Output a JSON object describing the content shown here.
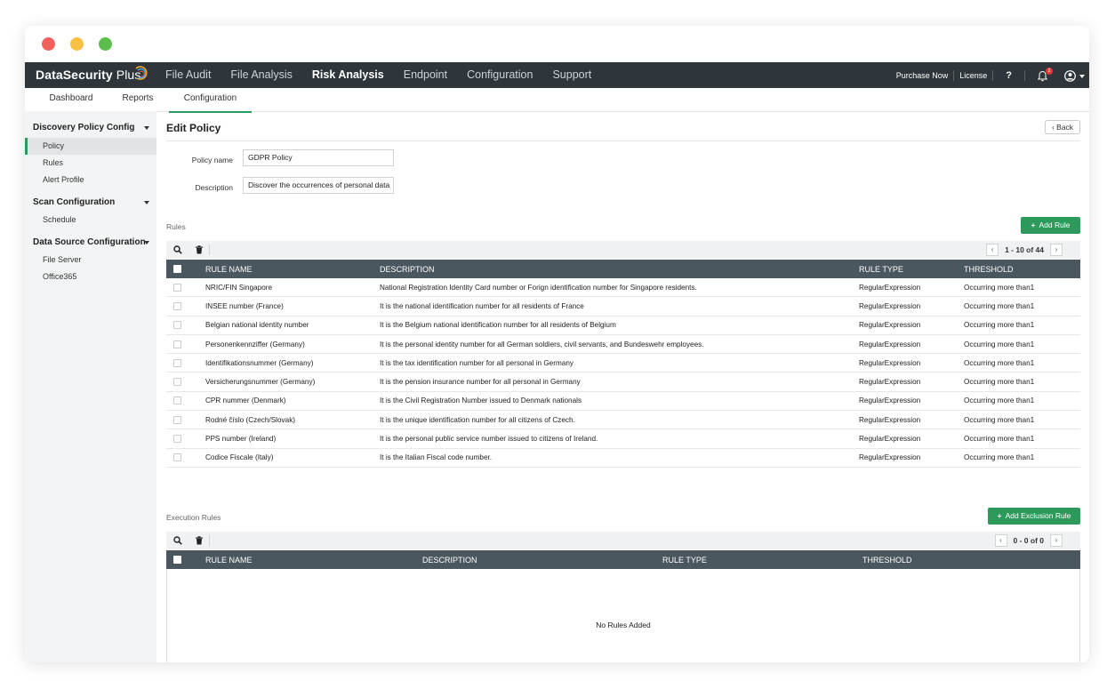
{
  "app": {
    "name": "DataSecurity",
    "name_suffix": " Plus"
  },
  "main_nav": [
    {
      "label": "File Audit",
      "active": false
    },
    {
      "label": "File Analysis",
      "active": false
    },
    {
      "label": "Risk Analysis",
      "active": true
    },
    {
      "label": "Endpoint",
      "active": false
    },
    {
      "label": "Configuration",
      "active": false
    },
    {
      "label": "Support",
      "active": false
    }
  ],
  "top_right": {
    "purchase": "Purchase Now",
    "license": "License",
    "help": "?",
    "notification_count": "2"
  },
  "sub_nav": {
    "dashboard": "Dashboard",
    "reports": "Reports",
    "configuration": "Configuration"
  },
  "sidebar": {
    "discovery": "Discovery Policy Config",
    "policy": "Policy",
    "rules": "Rules",
    "alert_profile": "Alert Profile",
    "scan": "Scan Configuration",
    "schedule": "Schedule",
    "data_source": "Data Source Configuration",
    "file_server": "File Server",
    "office365": "Office365"
  },
  "page": {
    "title": "Edit Policy",
    "back": "Back",
    "policy_name_label": "Policy name",
    "policy_name_value": "GDPR Policy",
    "description_label": "Description",
    "description_value": "Discover the occurrences of personal data"
  },
  "rules": {
    "label": "Rules",
    "add_button": "Add Rule",
    "pager": "1 - 10 of 44",
    "columns": {
      "name": "RULE NAME",
      "description": "DESCRIPTION",
      "type": "RULE TYPE",
      "threshold": "THRESHOLD"
    },
    "rows": [
      {
        "name": "NRIC/FIN Singapore",
        "description": "National Registration Identity Card number or Forign identification number for Singapore residents.",
        "type": "RegularExpression",
        "threshold": "Occurring more than1"
      },
      {
        "name": "INSEE number (France)",
        "description": "It is the national identification number for all residents of France",
        "type": "RegularExpression",
        "threshold": "Occurring more than1"
      },
      {
        "name": "Belgian national identity number",
        "description": "It is the Belgium national identification number for all residents of Belgium",
        "type": "RegularExpression",
        "threshold": "Occurring more than1"
      },
      {
        "name": "Personenkennziffer (Germany)",
        "description": "It is the personal identity number for all German soldiers, civil servants, and Bundeswehr employees.",
        "type": "RegularExpression",
        "threshold": "Occurring more than1"
      },
      {
        "name": "Identifikationsnummer (Germany)",
        "description": "It is the tax identification number for all personal in Germany",
        "type": "RegularExpression",
        "threshold": "Occurring more than1"
      },
      {
        "name": "Versicherungsnummer (Germany)",
        "description": "It is the pension insurance number for all personal in Germany",
        "type": "RegularExpression",
        "threshold": "Occurring more than1"
      },
      {
        "name": "CPR nummer (Denmark)",
        "description": "It is the Civil Registration Number issued to Denmark nationals",
        "type": "RegularExpression",
        "threshold": "Occurring more than1"
      },
      {
        "name": "Rodné číslo (Czech/Slovak)",
        "description": "It is the unique identification number for all citizens of Czech.",
        "type": "RegularExpression",
        "threshold": "Occurring more than1"
      },
      {
        "name": "PPS number (Ireland)",
        "description": "It is the personal public service number issued to citizens of Ireland.",
        "type": "RegularExpression",
        "threshold": "Occurring more than1"
      },
      {
        "name": "Codice Fiscale (Italy)",
        "description": "It is the Italian Fiscal code number.",
        "type": "RegularExpression",
        "threshold": "Occurring more than1"
      }
    ]
  },
  "execution": {
    "label": "Execution Rules",
    "add_button": "Add Exclusion Rule",
    "pager": "0 - 0 of 0",
    "columns": {
      "name": "RULE NAME",
      "description": "DESCRIPTION",
      "type": "RULE TYPE",
      "threshold": "THRESHOLD"
    },
    "empty": "No Rules Added"
  },
  "colors": {
    "accent": "#2d9a5b",
    "nav_bg": "#2e363b",
    "table_header": "#4a575e"
  }
}
